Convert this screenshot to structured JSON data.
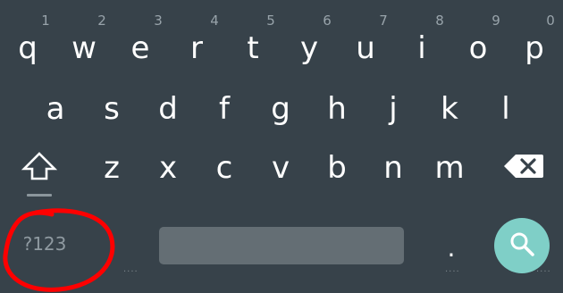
{
  "keyboard": {
    "rows": {
      "row1": {
        "keys": [
          {
            "label": "q",
            "hint": "1"
          },
          {
            "label": "w",
            "hint": "2"
          },
          {
            "label": "e",
            "hint": "3"
          },
          {
            "label": "r",
            "hint": "4"
          },
          {
            "label": "t",
            "hint": "5"
          },
          {
            "label": "y",
            "hint": "6"
          },
          {
            "label": "u",
            "hint": "7"
          },
          {
            "label": "i",
            "hint": "8"
          },
          {
            "label": "o",
            "hint": "9"
          },
          {
            "label": "p",
            "hint": "0"
          }
        ]
      },
      "row2": {
        "keys": [
          {
            "label": "a"
          },
          {
            "label": "s"
          },
          {
            "label": "d"
          },
          {
            "label": "f"
          },
          {
            "label": "g"
          },
          {
            "label": "h"
          },
          {
            "label": "j"
          },
          {
            "label": "k"
          },
          {
            "label": "l"
          }
        ]
      },
      "row3": {
        "keys": [
          {
            "label": "z"
          },
          {
            "label": "x"
          },
          {
            "label": "c"
          },
          {
            "label": "v"
          },
          {
            "label": "b"
          },
          {
            "label": "n"
          },
          {
            "label": "m"
          }
        ]
      }
    },
    "bottom": {
      "symbols_label": "?123",
      "period_label": ".",
      "more_indicator": "...."
    },
    "colors": {
      "background": "#37424a",
      "key_text": "#ffffff",
      "hint_text": "#98a3aa",
      "spacebar": "#646e74",
      "search_button": "#7fcfc7",
      "annotation_circle": "#ff0000"
    },
    "icons": {
      "shift": "shift-arrow-icon",
      "backspace": "backspace-icon",
      "search": "search-icon"
    }
  }
}
